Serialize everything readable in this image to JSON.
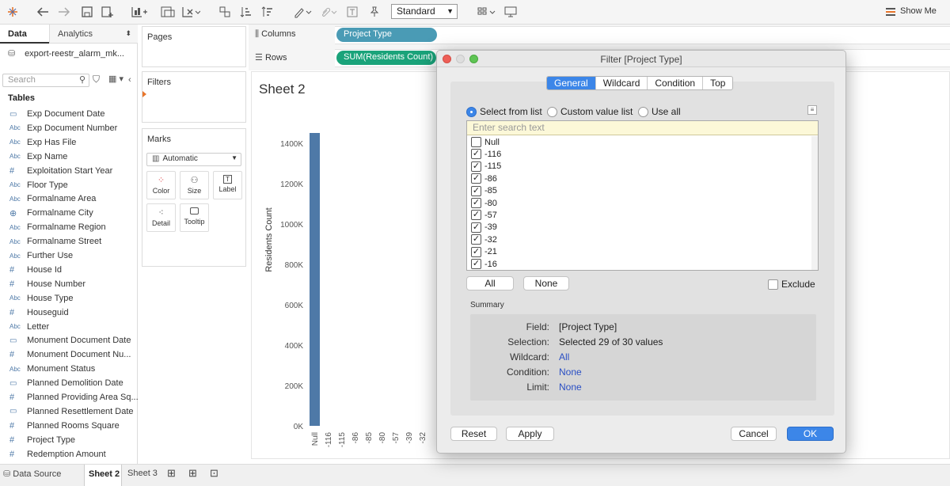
{
  "toolbar": {
    "view_mode": "Standard",
    "show_me": "Show Me"
  },
  "left": {
    "tabs": [
      "Data",
      "Analytics"
    ],
    "datasource": "export-reestr_alarm_mk...",
    "search_placeholder": "Search",
    "tables_label": "Tables",
    "fields": [
      {
        "type": "date",
        "label": "Exp Document Date"
      },
      {
        "type": "Abc",
        "label": "Exp Document Number"
      },
      {
        "type": "Abc",
        "label": "Exp Has File"
      },
      {
        "type": "Abc",
        "label": "Exp Name"
      },
      {
        "type": "#",
        "label": "Exploitation Start Year"
      },
      {
        "type": "Abc",
        "label": "Floor Type"
      },
      {
        "type": "Abc",
        "label": "Formalname Area"
      },
      {
        "type": "geo",
        "label": "Formalname City"
      },
      {
        "type": "Abc",
        "label": "Formalname Region"
      },
      {
        "type": "Abc",
        "label": "Formalname Street"
      },
      {
        "type": "Abc",
        "label": "Further Use"
      },
      {
        "type": "#",
        "label": "House Id"
      },
      {
        "type": "#",
        "label": "House Number"
      },
      {
        "type": "Abc",
        "label": "House Type"
      },
      {
        "type": "#",
        "label": "Houseguid"
      },
      {
        "type": "Abc",
        "label": "Letter"
      },
      {
        "type": "date",
        "label": "Monument Document Date"
      },
      {
        "type": "#",
        "label": "Monument Document Nu..."
      },
      {
        "type": "Abc",
        "label": "Monument Status"
      },
      {
        "type": "date",
        "label": "Planned Demolition Date"
      },
      {
        "type": "#",
        "label": "Planned Providing Area Sq..."
      },
      {
        "type": "date",
        "label": "Planned Resettlement Date"
      },
      {
        "type": "#",
        "label": "Planned Rooms Square"
      },
      {
        "type": "#",
        "label": "Project Type"
      },
      {
        "type": "#",
        "label": "Redemption Amount"
      }
    ]
  },
  "cards": {
    "pages": "Pages",
    "filters": "Filters",
    "marks": "Marks",
    "marks_type": "Automatic",
    "mark_buttons": [
      "Color",
      "Size",
      "Label",
      "Detail",
      "Tooltip"
    ]
  },
  "shelves": {
    "columns_label": "Columns",
    "rows_label": "Rows",
    "columns_pill": "Project Type",
    "rows_pill": "SUM(Residents Count)"
  },
  "sheet": {
    "title": "Sheet 2"
  },
  "chart_data": {
    "type": "bar",
    "ylabel": "Residents Count",
    "yticks": [
      "1400K",
      "1200K",
      "1000K",
      "800K",
      "600K",
      "400K",
      "200K",
      "0K"
    ],
    "ylim": [
      0,
      1450000
    ],
    "categories": [
      "Null",
      "-116",
      "-115",
      "-86",
      "-85",
      "-80",
      "-57",
      "-39",
      "-32"
    ],
    "values": [
      1450000,
      0,
      0,
      0,
      0,
      0,
      0,
      0,
      0
    ],
    "bar_color": "#4e79a7"
  },
  "bottom_tabs": {
    "data_source": "Data Source",
    "sheets": [
      "Sheet 2",
      "Sheet 3"
    ]
  },
  "dialog": {
    "title": "Filter [Project Type]",
    "tabs": [
      "General",
      "Wildcard",
      "Condition",
      "Top"
    ],
    "active_tab": "General",
    "radios": [
      "Select from list",
      "Custom value list",
      "Use all"
    ],
    "search_placeholder": "Enter search text",
    "items": [
      {
        "label": "Null",
        "checked": false
      },
      {
        "label": "-116",
        "checked": true
      },
      {
        "label": "-115",
        "checked": true
      },
      {
        "label": "-86",
        "checked": true
      },
      {
        "label": "-85",
        "checked": true
      },
      {
        "label": "-80",
        "checked": true
      },
      {
        "label": "-57",
        "checked": true
      },
      {
        "label": "-39",
        "checked": true
      },
      {
        "label": "-32",
        "checked": true
      },
      {
        "label": "-21",
        "checked": true
      },
      {
        "label": "-16",
        "checked": true
      }
    ],
    "all_button": "All",
    "none_button": "None",
    "exclude_label": "Exclude",
    "summary_label": "Summary",
    "summary": {
      "field_key": "Field:",
      "field_val": "[Project Type]",
      "selection_key": "Selection:",
      "selection_val": "Selected 29 of 30 values",
      "wildcard_key": "Wildcard:",
      "wildcard_val": "All",
      "condition_key": "Condition:",
      "condition_val": "None",
      "limit_key": "Limit:",
      "limit_val": "None"
    },
    "reset_button": "Reset",
    "apply_button": "Apply",
    "cancel_button": "Cancel",
    "ok_button": "OK"
  }
}
